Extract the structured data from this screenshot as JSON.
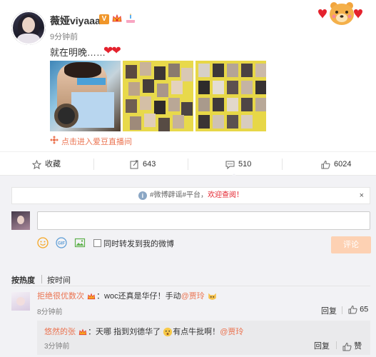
{
  "post": {
    "username": "薇娅viyaaa",
    "verified_badge": "V",
    "time": "9分钟前",
    "text": "就在明晚……",
    "text_emoji": "❤❤",
    "photos": [
      "photo-1",
      "photo-2",
      "photo-3"
    ],
    "live_link": "点击进入爱豆直播间"
  },
  "actions": {
    "favorite_label": "收藏",
    "repost_count": "643",
    "comment_count": "510",
    "like_count": "6024"
  },
  "comment_box": {
    "notice_prefix": "#微博辟谣#平台，",
    "notice_link": "欢迎查阅！",
    "notice_close": "×",
    "input_value": "",
    "repost_checkbox_label": "同时转发到我的微博",
    "submit_label": "评论"
  },
  "sort": {
    "hot_label": "按热度",
    "time_label": "按时间"
  },
  "comments": [
    {
      "user": "拒绝很优数次",
      "text": "：woc还真是华仔！手动",
      "mention": "@贾玲",
      "time": "8分钟前",
      "reply_label": "回复",
      "likes": "65"
    }
  ],
  "reply": {
    "user": "悠然的张",
    "text_a": "：天哪 指到刘德华了",
    "text_b": "有点牛批啊！",
    "mention": "@贾玲",
    "time": "3分钟前",
    "reply_label": "回复",
    "like_label": "赞"
  },
  "colors": {
    "accent_orange": "#eb7350",
    "heart_red": "#e4222d",
    "comment_bg": "#f2f2f5",
    "button_disabled": "#fdd1b3"
  },
  "icons": [
    "star-icon",
    "repost-icon",
    "comment-icon",
    "thumb-up-icon",
    "info-icon",
    "emoji-icon",
    "gif-icon",
    "image-icon",
    "crown-icon",
    "cake-icon",
    "live-icon",
    "bear-icon"
  ]
}
